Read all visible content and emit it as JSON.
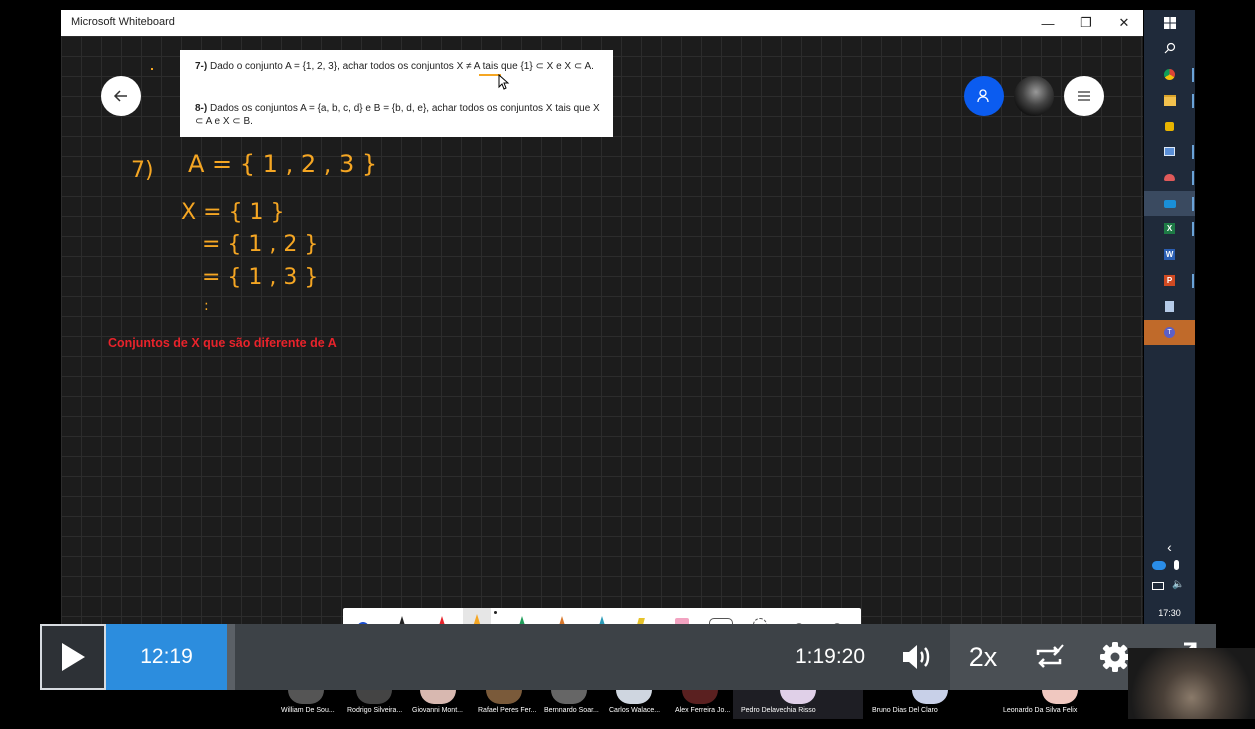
{
  "window": {
    "title": "Microsoft Whiteboard",
    "controls": [
      "—",
      "❐",
      "✕"
    ]
  },
  "question_card": {
    "q7_num": "7-)",
    "q7_text": "Dado o conjunto A = {1, 2, 3}, achar todos os conjuntos X ≠ A tais que {1} ⊂ X e X ⊂ A.",
    "q8_num": "8-)",
    "q8_text": "Dados os conjuntos A = {a, b, c, d} e B = {b, d, e}, achar todos os conjuntos X tais que X ⊂ A e X ⊂ B."
  },
  "handwriting": {
    "label": "7)",
    "line1": "A = { 1 , 2 , 3 }",
    "line2": "X = { 1 }",
    "line3": "= { 1 , 2 }",
    "line4": "= { 1 , 3 }",
    "line5": ":"
  },
  "annotation": "Conjuntos de X que são diferente de A",
  "taskbar": {
    "time": "17:30"
  },
  "player": {
    "current_time": "12:19",
    "duration": "1:19:20",
    "speed": "2x",
    "progress": 0.012
  },
  "participants": [
    {
      "name": "William De Sou..."
    },
    {
      "name": "Rodrigo Silveira..."
    },
    {
      "name": "Giovanni Mont..."
    },
    {
      "name": "Rafael Peres Fer..."
    },
    {
      "name": "Bernnardo Soar..."
    },
    {
      "name": "Carlos Walace..."
    },
    {
      "name": "Alex Ferreira Jo..."
    },
    {
      "name": "Pedro Delavechia Risso"
    },
    {
      "name": "Bruno Dias Del Claro"
    },
    {
      "name": "Leonardo Da Silva Felix"
    }
  ],
  "colors": {
    "accent": "#2c8dde",
    "ink": "#f5a623",
    "annotation": "#e8232b",
    "share_button": "#0b5cf0"
  }
}
